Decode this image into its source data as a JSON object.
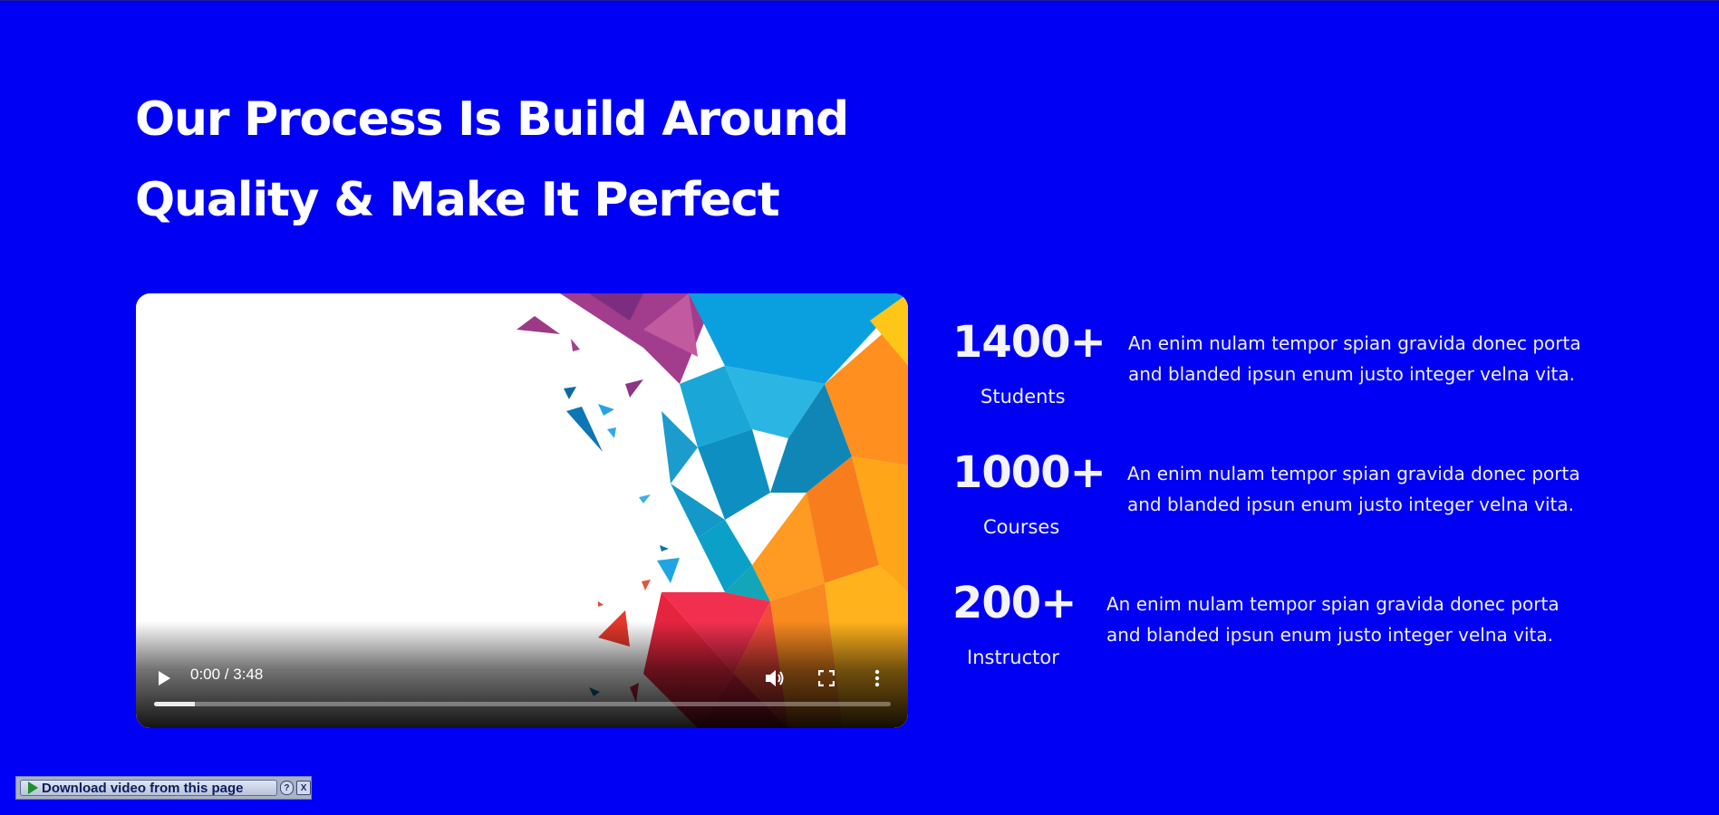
{
  "heading": {
    "line1": "Our Process Is Build Around",
    "line2": "Quality & Make It Perfect"
  },
  "video": {
    "current_time": "0:00",
    "duration": "3:48",
    "time_display": "0:00 / 3:48",
    "progress_fraction": 0.055,
    "icons": [
      "play-icon",
      "volume-icon",
      "fullscreen-icon",
      "more-options-icon"
    ]
  },
  "stats": [
    {
      "number": "1400+",
      "label": "Students",
      "desc_line1": "An enim nulam tempor spian gravida donec porta",
      "desc_line2": "and blanded ipsun enum justo integer velna vita."
    },
    {
      "number": "1000+",
      "label": "Courses",
      "desc_line1": "An enim nulam tempor spian gravida donec porta",
      "desc_line2": "and blanded ipsun enum justo integer velna vita."
    },
    {
      "number": "200+",
      "label": "Instructor",
      "desc_line1": "An enim nulam tempor spian gravida donec porta",
      "desc_line2": "and blanded ipsun enum justo integer velna vita."
    }
  ],
  "download_bar": {
    "label": "Download video from this page",
    "help": "?",
    "close": "X"
  },
  "colors": {
    "background": "#0000f4",
    "text": "#ffffff"
  }
}
